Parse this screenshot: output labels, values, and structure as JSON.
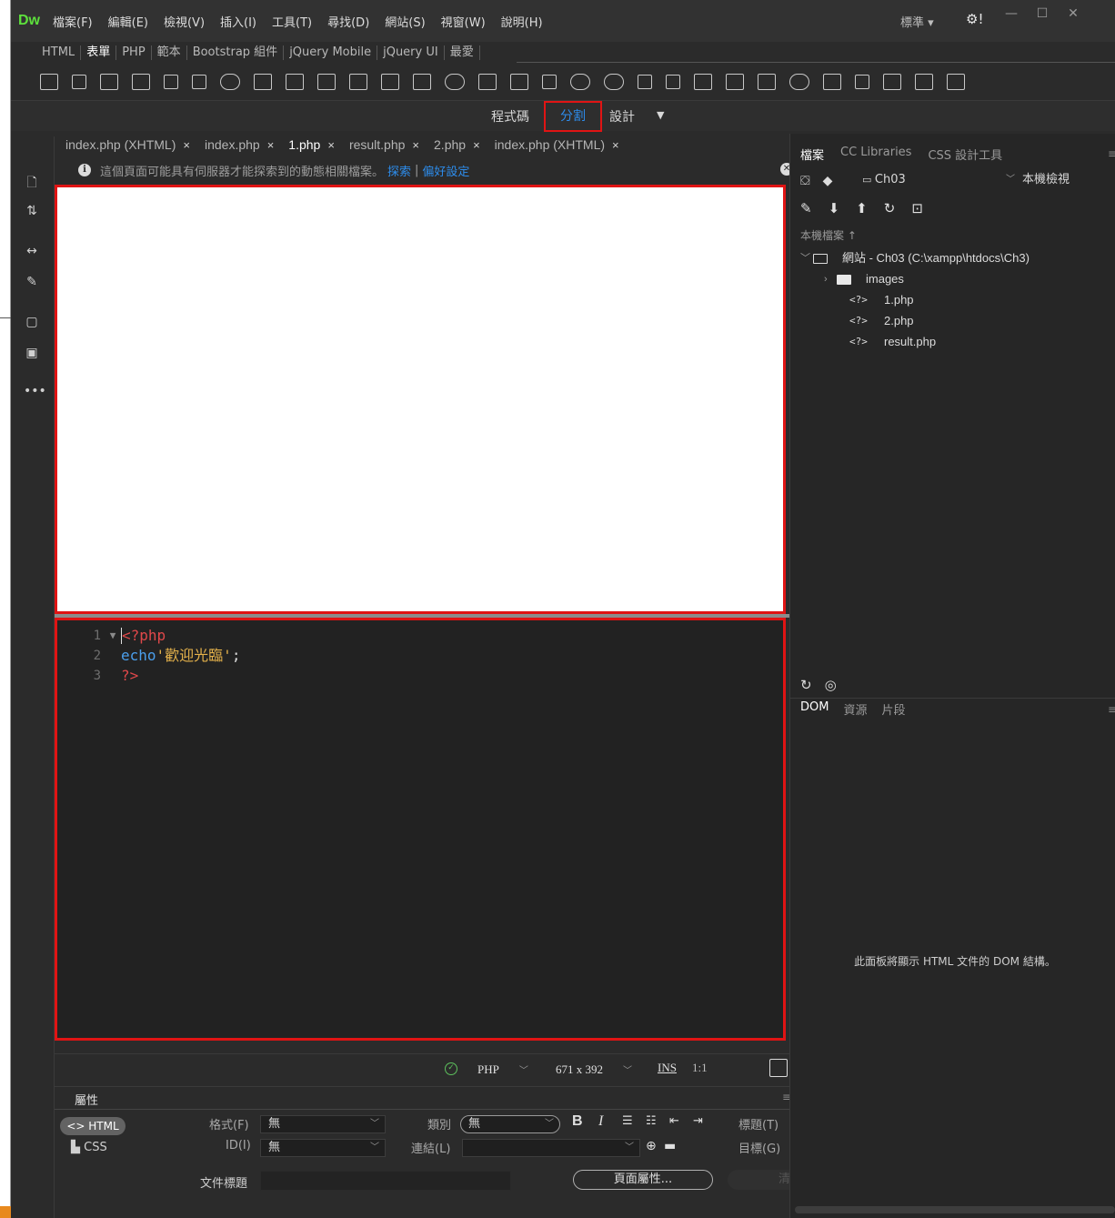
{
  "app": {
    "logo": "Dw",
    "menu": [
      "檔案(F)",
      "編輯(E)",
      "檢視(V)",
      "插入(I)",
      "工具(T)",
      "尋找(D)",
      "網站(S)",
      "視窗(W)",
      "說明(H)"
    ],
    "workspace": "標準 ▾",
    "gear": "⚙!",
    "window_buttons": [
      "—",
      "☐",
      "✕"
    ]
  },
  "insert_tabs": [
    "HTML",
    "表單",
    "PHP",
    "範本",
    "Bootstrap 組件",
    "jQuery Mobile",
    "jQuery UI",
    "最愛"
  ],
  "insert_active": "表單",
  "view": {
    "code": "程式碼",
    "split": "分割",
    "design": "設計",
    "caret": "▼"
  },
  "doc_tabs": [
    {
      "label": "index.php (XHTML)",
      "active": false
    },
    {
      "label": "index.php",
      "active": false
    },
    {
      "label": "1.php",
      "active": true
    },
    {
      "label": "result.php",
      "active": false
    },
    {
      "label": "2.php",
      "active": false
    },
    {
      "label": "index.php (XHTML)",
      "active": false
    }
  ],
  "close_glyph": "×",
  "infobar": {
    "icon": "i",
    "message": "這個頁面可能具有伺服器才能探索到的動態相關檔案。",
    "link_discover": "探索",
    "separator": "|",
    "link_prefs": "偏好設定",
    "close": "✕"
  },
  "code": [
    {
      "num": "1",
      "fold": "▼",
      "tokens": [
        {
          "cls": "tok-php",
          "text": "<?php"
        }
      ]
    },
    {
      "num": "2",
      "fold": "",
      "tokens": [
        {
          "cls": "tok-echo",
          "text": "echo "
        },
        {
          "cls": "tok-str",
          "text": "'歡迎光臨'"
        },
        {
          "cls": "tok-plain",
          "text": ";"
        }
      ]
    },
    {
      "num": "3",
      "fold": "",
      "tokens": [
        {
          "cls": "tok-php",
          "text": "?>"
        }
      ]
    }
  ],
  "status": {
    "ok": "✓",
    "doctype": "PHP",
    "size": "671 x 392",
    "ins": "INS",
    "position": "1:1"
  },
  "properties": {
    "title": "屬性",
    "menu": "≡",
    "html_btn": "<> HTML",
    "css_btn": "CSS",
    "format_label": "格式(F)",
    "format_value": "無",
    "id_label": "ID(I)",
    "id_value": "無",
    "class_label": "類別",
    "class_value": "無",
    "link_label": "連結(L)",
    "link_value": "",
    "title_label": "標題(T)",
    "target_label": "目標(G)",
    "doc_title_label": "文件標題",
    "doc_title_value": "",
    "page_props": "頁面屬性...",
    "clear": "清單",
    "bold": "B",
    "italic": "I"
  },
  "files_panel": {
    "tabs": [
      "檔案",
      "CC Libraries",
      "CSS 設計工具"
    ],
    "site": "Ch03",
    "view": "本機檢視",
    "local_label": "本機檔案 ↑",
    "root": "網站 - Ch03 (C:\\xampp\\htdocs\\Ch3)",
    "items": [
      {
        "type": "folder",
        "name": "images"
      },
      {
        "type": "php",
        "name": "1.php"
      },
      {
        "type": "php",
        "name": "2.php"
      },
      {
        "type": "php",
        "name": "result.php"
      }
    ],
    "php_glyph": "<?>"
  },
  "dom_panel": {
    "tabs": [
      "DOM",
      "資源",
      "片段"
    ],
    "message": "此面板將顯示 HTML 文件的 DOM 結構。"
  }
}
